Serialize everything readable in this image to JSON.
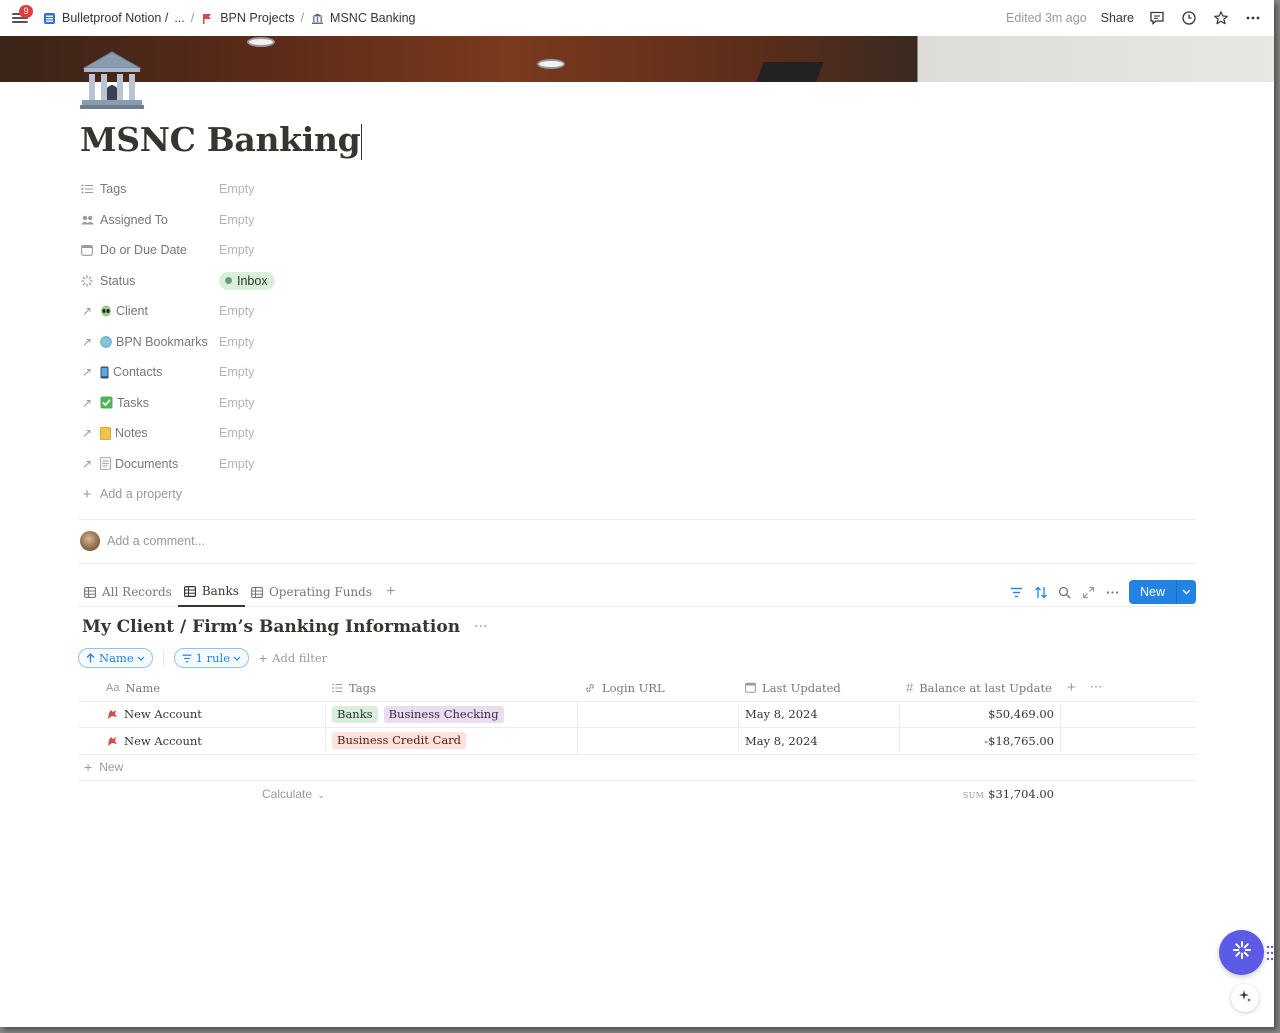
{
  "topbar": {
    "notification_count": "9",
    "breadcrumbs": [
      {
        "label": "Bulletproof Notion /",
        "icon": "database-icon"
      },
      {
        "label": "...",
        "icon": ""
      },
      {
        "label": "BPN Projects",
        "icon": "projects-icon"
      },
      {
        "label": "MSNC Banking",
        "icon": "bank-icon"
      }
    ],
    "separator": "/",
    "edited": "Edited 3m ago",
    "share_label": "Share"
  },
  "page": {
    "title": "MSNC Banking",
    "icon": "bank-building-icon"
  },
  "properties": [
    {
      "name": "Tags",
      "icon": "list-icon",
      "value": "Empty"
    },
    {
      "name": "Assigned To",
      "icon": "people-icon",
      "value": "Empty"
    },
    {
      "name": "Do or Due Date",
      "icon": "calendar-icon",
      "value": "Empty"
    },
    {
      "name": "Status",
      "icon": "status-icon",
      "value": "Inbox"
    },
    {
      "name": "Client",
      "icon": "relation-arrow-icon",
      "emoji": "alien-icon",
      "value": "Empty"
    },
    {
      "name": "BPN Bookmarks",
      "icon": "relation-arrow-icon",
      "emoji": "globe-icon",
      "value": "Empty"
    },
    {
      "name": "Contacts",
      "icon": "relation-arrow-icon",
      "emoji": "phone-icon",
      "value": "Empty"
    },
    {
      "name": "Tasks",
      "icon": "relation-arrow-icon",
      "emoji": "checkmark-icon",
      "value": "Empty"
    },
    {
      "name": "Notes",
      "icon": "relation-arrow-icon",
      "emoji": "notepad-icon",
      "value": "Empty"
    },
    {
      "name": "Documents",
      "icon": "relation-arrow-icon",
      "emoji": "document-icon",
      "value": "Empty"
    }
  ],
  "add_property_label": "Add a property",
  "comment_placeholder": "Add a comment...",
  "views": {
    "tabs": [
      {
        "label": "All Records"
      },
      {
        "label": "Banks"
      },
      {
        "label": "Operating Funds"
      }
    ],
    "new_label": "New"
  },
  "database": {
    "title": "My Client / Firm’s Banking Information",
    "sort_chip": "Name",
    "filter_chip": "1 rule",
    "add_filter": "Add filter",
    "columns": [
      {
        "label": "Name",
        "icon": "Aa"
      },
      {
        "label": "Tags",
        "icon": "list-icon"
      },
      {
        "label": "Login URL",
        "icon": "link-icon"
      },
      {
        "label": "Last Updated",
        "icon": "calendar-icon"
      },
      {
        "label": "Balance at last Update",
        "icon": "#"
      }
    ],
    "rows": [
      {
        "name": "New Account",
        "tags": [
          {
            "label": "Banks",
            "bg": "#dbeddb",
            "fg": "#1c3829"
          },
          {
            "label": "Business Checking",
            "bg": "#e8deee",
            "fg": "#412454"
          }
        ],
        "login_url": "",
        "last_updated": "May 8, 2024",
        "balance": "$50,469.00"
      },
      {
        "name": "New Account",
        "tags": [
          {
            "label": "Business Credit Card",
            "bg": "#ffe2dd",
            "fg": "#5d1715"
          }
        ],
        "login_url": "",
        "last_updated": "May 8, 2024",
        "balance": "-$18,765.00"
      }
    ],
    "new_row_label": "New",
    "calculate_label": "Calculate",
    "sum_label": "SUM",
    "sum_value": "$31,704.00"
  },
  "colors": {
    "accent": "#2383e2",
    "text": "#37352f",
    "muted": "#9b9a97",
    "ai_button": "#5b5be8"
  }
}
